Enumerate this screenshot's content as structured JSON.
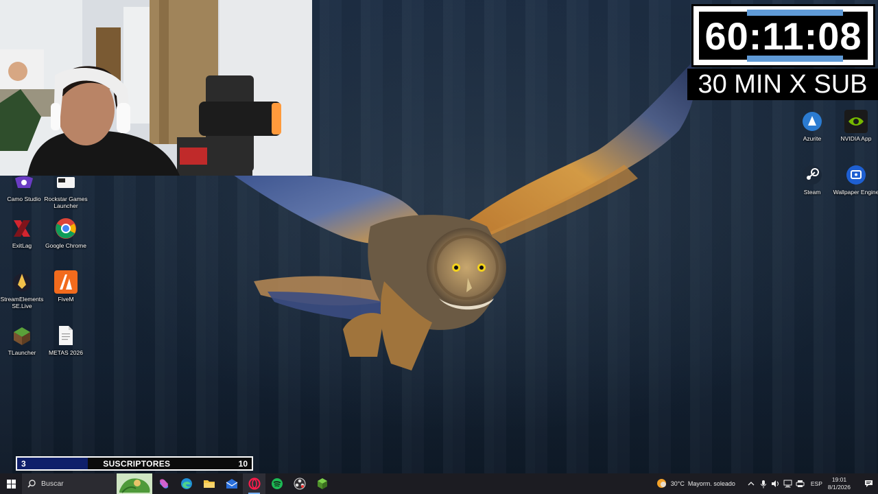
{
  "desktop_left_icons": [
    {
      "label": "Camo Studio",
      "icon": "camo-studio-icon"
    },
    {
      "label": "Rockstar Games\nLauncher",
      "icon": "rockstar-icon"
    },
    {
      "label": "ExitLag",
      "icon": "exitlag-icon"
    },
    {
      "label": "Google Chrome",
      "icon": "chrome-icon"
    },
    {
      "label": "StreamElements\nSE.Live",
      "icon": "streamelements-icon"
    },
    {
      "label": "FiveM",
      "icon": "fivem-icon"
    },
    {
      "label": "TLauncher",
      "icon": "tlauncher-icon"
    },
    {
      "label": "METAS 2026",
      "icon": "text-file-icon"
    }
  ],
  "desktop_right_icons": [
    {
      "label": "Azurite",
      "icon": "azurite-icon"
    },
    {
      "label": "NVIDIA App",
      "icon": "nvidia-icon"
    },
    {
      "label": "Steam",
      "icon": "steam-icon"
    },
    {
      "label": "Wallpaper Engine",
      "icon": "wallpaper-engine-icon"
    }
  ],
  "stream_overlay": {
    "timer": "60:11:08",
    "rule": "30 MIN X SUB",
    "goal": {
      "current": "3",
      "label": "SUSCRIPTORES",
      "target": "10",
      "progress_fraction": 0.3
    }
  },
  "taskbar": {
    "search_placeholder": "Buscar",
    "apps": [
      "copilot-icon",
      "edge-icon",
      "file-explorer-icon",
      "mail-icon",
      "opera-gx-icon",
      "spotify-icon",
      "obs-icon",
      "minecraft-icon"
    ],
    "active_app": "opera-gx-icon",
    "weather_temp": "30°C",
    "weather_desc": "Mayorm. soleado",
    "language": "ESP",
    "time": "19:01",
    "date": "8/1/2026"
  },
  "colors": {
    "taskbar_bg": "#1c1c22",
    "goal_fill": "#0f1f6a",
    "timer_accent": "#5f9ad6"
  }
}
